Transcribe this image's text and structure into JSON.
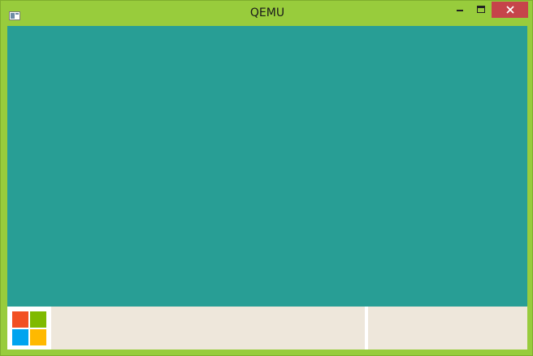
{
  "window": {
    "title": "QEMU",
    "controls": {
      "minimize_icon": "minimize-icon",
      "maximize_icon": "maximize-icon",
      "close_icon": "close-icon"
    },
    "frame_color": "#98cc3c",
    "close_color": "#c6444a"
  },
  "desktop": {
    "background_color": "#289e95"
  },
  "taskbar": {
    "background_color": "#eee7db",
    "start_icon": "windows-logo-icon",
    "logo_colors": [
      "#f25022",
      "#7fba00",
      "#00a4ef",
      "#ffb900"
    ]
  }
}
